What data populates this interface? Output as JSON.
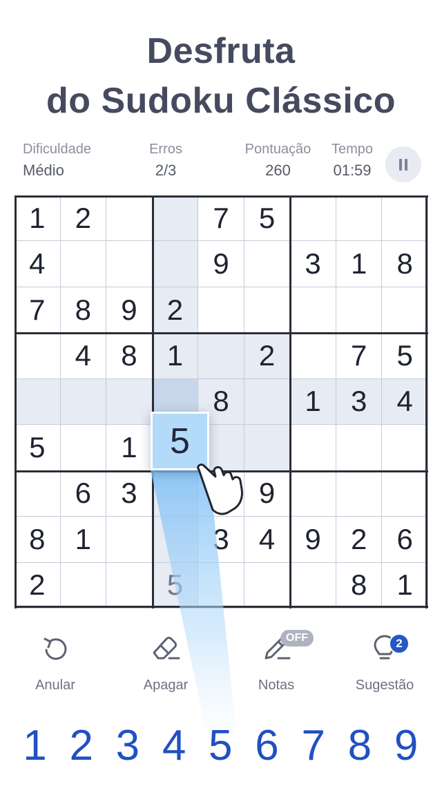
{
  "headline": {
    "line1": "Desfruta",
    "line2": "do Sudoku Clássico"
  },
  "stats": {
    "difficulty_label": "Dificuldade",
    "difficulty_value": "Médio",
    "errors_label": "Erros",
    "errors_value": "2/3",
    "score_label": "Pontuação",
    "score_value": "260",
    "time_label": "Tempo",
    "time_value": "01:59"
  },
  "pause_icon": "pause-icon",
  "board": {
    "cells": [
      [
        "1",
        "2",
        "",
        "",
        "7",
        "5",
        "",
        "",
        ""
      ],
      [
        "4",
        "",
        "",
        "",
        "9",
        "",
        "3",
        "1",
        "8"
      ],
      [
        "7",
        "8",
        "9",
        "2",
        "",
        "",
        "",
        "",
        ""
      ],
      [
        "",
        "4",
        "8",
        "1",
        "",
        "2",
        "",
        "7",
        "5"
      ],
      [
        "",
        "",
        "",
        "",
        "8",
        "",
        "1",
        "3",
        "4"
      ],
      [
        "5",
        "",
        "1",
        "",
        "",
        "",
        "",
        "",
        ""
      ],
      [
        "",
        "6",
        "3",
        "",
        "",
        "9",
        "",
        "",
        ""
      ],
      [
        "8",
        "1",
        "",
        "",
        "3",
        "4",
        "9",
        "2",
        "6"
      ],
      [
        "2",
        "",
        "",
        "5",
        "",
        "",
        "",
        "8",
        "1"
      ]
    ],
    "selected_cell": {
      "row": 5,
      "col": 3
    },
    "selected_value": "5",
    "highlight_color": "#e6ebf4",
    "selected_color": "#c7d6ea",
    "popup_color": "#b4dafa"
  },
  "tools": [
    {
      "label": "Anular",
      "icon": "undo-icon"
    },
    {
      "label": "Apagar",
      "icon": "eraser-icon"
    },
    {
      "label": "Notas",
      "icon": "pencil-icon",
      "badge": "OFF"
    },
    {
      "label": "Sugestão",
      "icon": "lightbulb-icon",
      "badge": "2"
    }
  ],
  "numpad": [
    "1",
    "2",
    "3",
    "4",
    "5",
    "6",
    "7",
    "8",
    "9"
  ],
  "colors": {
    "accent": "#2050c2",
    "headline": "#454a5e"
  }
}
